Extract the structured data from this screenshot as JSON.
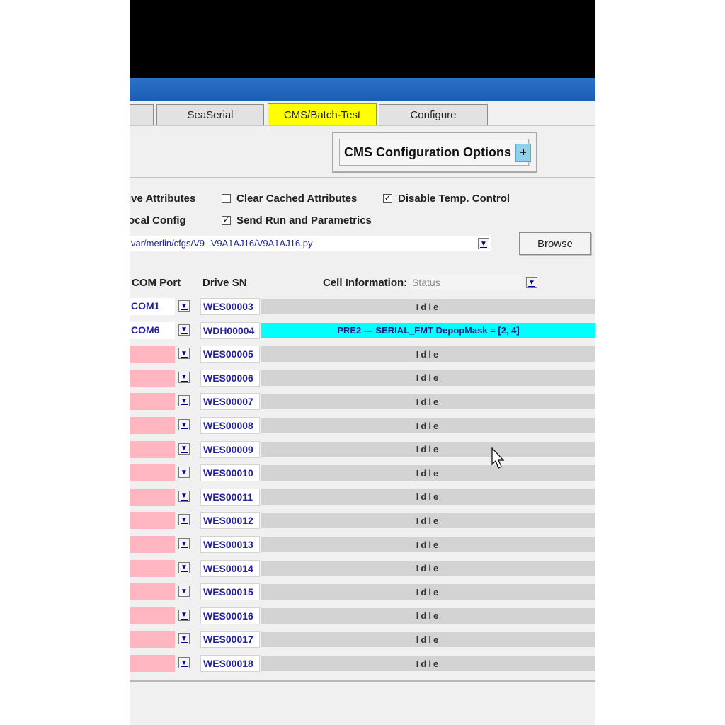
{
  "tabs": [
    {
      "label": ""
    },
    {
      "label": "SeaSerial"
    },
    {
      "label": "CMS/Batch-Test",
      "active": true
    },
    {
      "label": "Configure"
    }
  ],
  "cms_options": {
    "label": "CMS Configuration Options",
    "expand": "+"
  },
  "options": {
    "drive_attributes": {
      "label": "ive Attributes"
    },
    "clear_cached": {
      "label": "Clear Cached Attributes",
      "checked": false
    },
    "disable_temp": {
      "label": "Disable Temp. Control",
      "checked": true
    },
    "local_config": {
      "label": "ocal Config"
    },
    "send_run": {
      "label": "Send Run and Parametrics",
      "checked": true
    }
  },
  "config_path": "var/merlin/cfgs/V9--V9A1AJ16/V9A1AJ16.py",
  "browse_label": "Browse",
  "headers": {
    "com_port": "COM Port",
    "drive_sn": "Drive SN",
    "cell_info": "Cell Information:",
    "cell_info_value": "Status"
  },
  "rows": [
    {
      "com": "COM1",
      "sn": "WES00003",
      "status": "Idle"
    },
    {
      "com": "COM6",
      "sn": "WDH00004",
      "status": "PRE2 --- SERIAL_FMT   DepopMask = [2, 4]",
      "active": true
    },
    {
      "com": "",
      "sn": "WES00005",
      "status": "Idle"
    },
    {
      "com": "",
      "sn": "WES00006",
      "status": "Idle"
    },
    {
      "com": "",
      "sn": "WES00007",
      "status": "Idle"
    },
    {
      "com": "",
      "sn": "WES00008",
      "status": "Idle"
    },
    {
      "com": "",
      "sn": "WES00009",
      "status": "Idle"
    },
    {
      "com": "",
      "sn": "WES00010",
      "status": "Idle"
    },
    {
      "com": "",
      "sn": "WES00011",
      "status": "Idle"
    },
    {
      "com": "",
      "sn": "WES00012",
      "status": "Idle"
    },
    {
      "com": "",
      "sn": "WES00013",
      "status": "Idle"
    },
    {
      "com": "",
      "sn": "WES00014",
      "status": "Idle"
    },
    {
      "com": "",
      "sn": "WES00015",
      "status": "Idle"
    },
    {
      "com": "",
      "sn": "WES00016",
      "status": "Idle"
    },
    {
      "com": "",
      "sn": "WES00017",
      "status": "Idle"
    },
    {
      "com": "",
      "sn": "WES00018",
      "status": "Idle"
    }
  ],
  "colors": {
    "active_tab": "#ffff00",
    "active_row": "#00ffff",
    "empty_com": "#ffb6c1",
    "idle_cell": "#d3d3d3",
    "title_bar": "#1c5fb4"
  },
  "icons": {
    "dropdown": "dropdown-arrow-icon",
    "cursor": "mouse-pointer-icon"
  }
}
